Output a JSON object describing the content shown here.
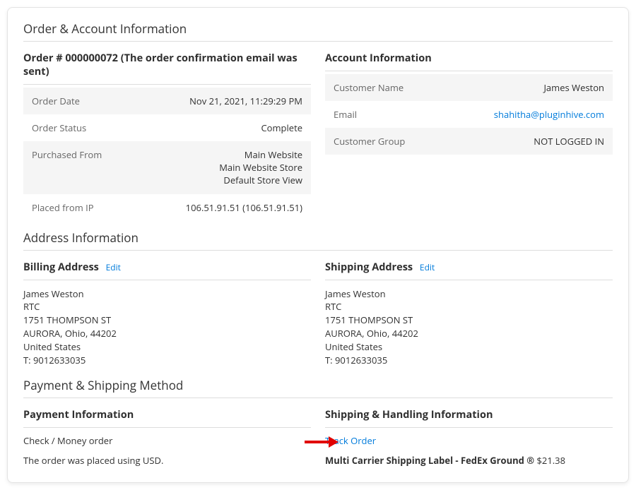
{
  "section_order_account_title": "Order & Account Information",
  "order_title": "Order # 000000072 (The order confirmation email was sent)",
  "account_title": "Account Information",
  "order_rows": {
    "date_label": "Order Date",
    "date_value": "Nov 21, 2021, 11:29:29 PM",
    "status_label": "Order Status",
    "status_value": "Complete",
    "purchased_label": "Purchased From",
    "purchased_l1": "Main Website",
    "purchased_l2": "Main Website Store",
    "purchased_l3": "Default Store View",
    "ip_label": "Placed from IP",
    "ip_value": "106.51.91.51 (106.51.91.51)"
  },
  "account_rows": {
    "name_label": "Customer Name",
    "name_value": "James Weston",
    "email_label": "Email",
    "email_value": "shahitha@pluginhive.com",
    "group_label": "Customer Group",
    "group_value": "NOT LOGGED IN"
  },
  "section_address_title": "Address Information",
  "billing_title": "Billing Address",
  "shipping_title": "Shipping Address",
  "edit_label": "Edit",
  "address": {
    "name": "James Weston",
    "company": "RTC",
    "street": "1751 THOMPSON ST",
    "city": "AURORA, Ohio, 44202",
    "country": "United States",
    "phone": "T: 9012633035"
  },
  "section_payship_title": "Payment & Shipping Method",
  "payment_title": "Payment Information",
  "shipping_info_title": "Shipping & Handling Information",
  "payment": {
    "method": "Check / Money order",
    "note": "The order was placed using USD."
  },
  "shipping_info": {
    "track_label": "Track Order",
    "label_prefix": "Multi Carrier Shipping Label - FedEx Ground ® ",
    "amount": "$21.38"
  }
}
